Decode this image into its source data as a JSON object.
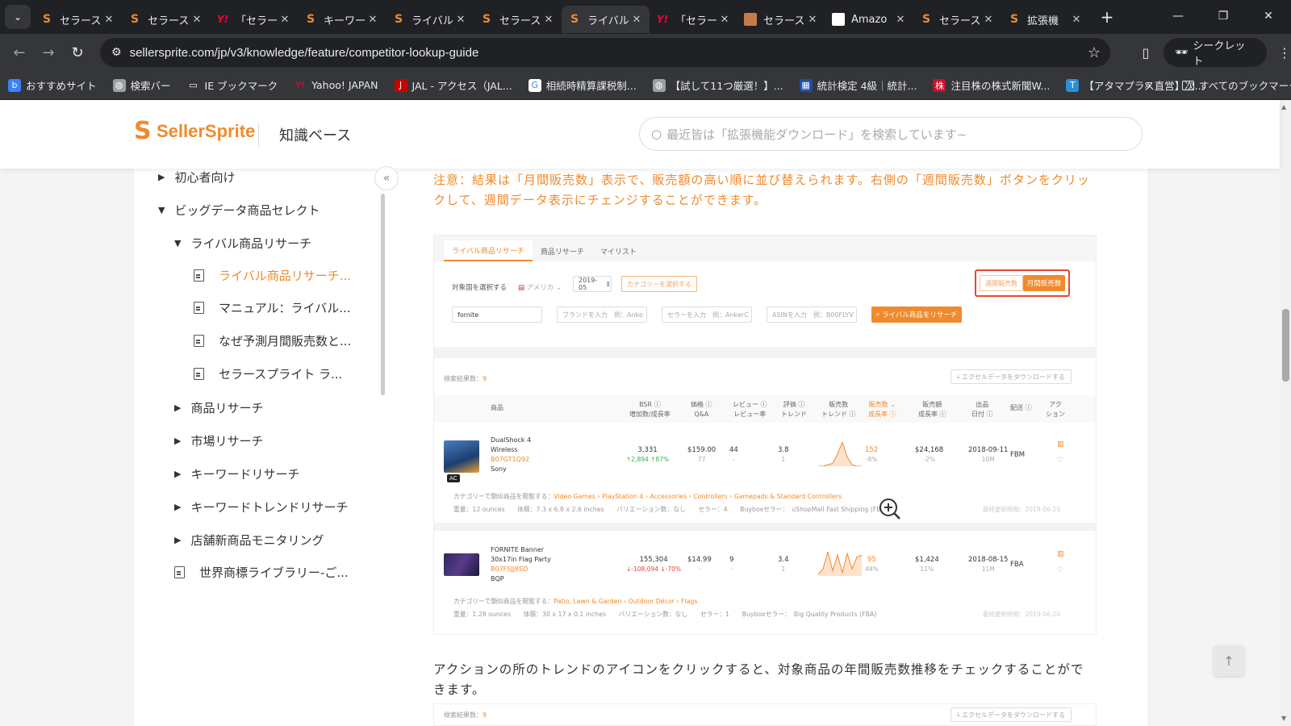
{
  "browser": {
    "tabs": [
      {
        "title": "セラース",
        "icon": "sellersprite-icon",
        "active": false
      },
      {
        "title": "セラース",
        "icon": "sellersprite-icon",
        "active": false
      },
      {
        "title": "「セラース",
        "icon": "yahoo-icon",
        "active": false
      },
      {
        "title": "キーワー",
        "icon": "sellersprite-icon",
        "active": false
      },
      {
        "title": "ライバル",
        "icon": "sellersprite-icon",
        "active": false
      },
      {
        "title": "セラース",
        "icon": "sellersprite-icon",
        "active": false
      },
      {
        "title": "ライバル",
        "icon": "sellersprite-icon",
        "active": true
      },
      {
        "title": "「セラース",
        "icon": "yahoo-icon",
        "active": false
      },
      {
        "title": "セラース",
        "icon": "person-photo-icon",
        "active": false
      },
      {
        "title": "Amazo",
        "icon": "amazon-icon",
        "active": false
      },
      {
        "title": "セラース",
        "icon": "sellersprite-icon",
        "active": false
      },
      {
        "title": "拡張機",
        "icon": "sellersprite-icon",
        "active": false
      }
    ],
    "url": "sellersprite.com/jp/v3/knowledge/feature/competitor-lookup-guide",
    "incognito_label": "シークレット",
    "bookmarks": [
      {
        "label": "おすすめサイト",
        "icon": "bing-icon"
      },
      {
        "label": "検索バー",
        "icon": "globe-icon"
      },
      {
        "label": "IE ブックマーク",
        "icon": "folder-icon"
      },
      {
        "label": "Yahoo! JAPAN",
        "icon": "yahoo-icon"
      },
      {
        "label": "JAL - アクセス（JAL...",
        "icon": "jal-icon"
      },
      {
        "label": "相続時精算課税制...",
        "icon": "google-icon"
      },
      {
        "label": "【試して11つ厳選！】...",
        "icon": "globe-icon"
      },
      {
        "label": "統計検定 4級｜統計...",
        "icon": "jssc-icon"
      },
      {
        "label": "注目株の株式新聞W...",
        "icon": "kabushiki-icon"
      },
      {
        "label": "【アタマプラス直営】次...",
        "icon": "t-icon"
      }
    ],
    "all_bookmarks_label": "すべてのブックマーク"
  },
  "header": {
    "logo_text": "SellerSprite",
    "section_title": "知識ベース",
    "search_placeholder": "最近皆は「拡張機能ダウンロード」を検索しています~"
  },
  "sidebar": {
    "items": [
      {
        "label": "初心者向け",
        "kind": "collapsed"
      },
      {
        "label": "ビッグデータ商品セレクト",
        "kind": "expanded"
      },
      {
        "label": "ライバル商品リサーチ",
        "kind": "expanded"
      },
      {
        "label": "ライバル商品リサーチ...",
        "kind": "doc-selected"
      },
      {
        "label": "マニュアル：ライバル...",
        "kind": "doc"
      },
      {
        "label": "なぜ予測月間販売数と...",
        "kind": "doc"
      },
      {
        "label": "セラースプライト ラ...",
        "kind": "doc"
      },
      {
        "label": "商品リサーチ",
        "kind": "collapsed"
      },
      {
        "label": "市場リサーチ",
        "kind": "collapsed"
      },
      {
        "label": "キーワードリサーチ",
        "kind": "collapsed"
      },
      {
        "label": "キーワードトレンドリサーチ",
        "kind": "collapsed"
      },
      {
        "label": "店舗新商品モニタリング",
        "kind": "collapsed"
      },
      {
        "label": "世界商標ライブラリー-ご...",
        "kind": "doc"
      }
    ]
  },
  "article": {
    "note": "注意：結果は「月間販売数」表示で、販売額の高い順に並び替えられます。右側の「週間販売数」ボタンをクリックして、週間データ表示にチェンジすることができます。",
    "paragraph": "アクションの所のトレンドのアイコンをクリックすると、対象商品の年間販売数推移をチェックすることができます。"
  },
  "screenshot": {
    "tabs": [
      "ライバル商品リサーチ",
      "商品リサーチ",
      "マイリスト"
    ],
    "country_label": "対象国を選択する",
    "country_value": "アメリカ",
    "date_value": "2019-05",
    "category_button": "カテゴリーを選択する",
    "weekly_label": "週間販売数",
    "monthly_label": "月間販売数",
    "keyword_value": "fornite",
    "brand_placeholder": "ブランドを入力　例：Anke",
    "seller_placeholder": "セラーを入力　例：AnkerC",
    "asin_placeholder": "ASINを入力　例：B00FLYV",
    "search_button": "ライバル商品をリサーチ",
    "results_label": "検索結果数：",
    "results_count": "9",
    "download_button": "エクセルデータをダウンロードする",
    "columns": [
      {
        "l1": "商品",
        "l2": ""
      },
      {
        "l1": "BSR ⓘ",
        "l2": "増加数/成長率"
      },
      {
        "l1": "価格 ⓘ",
        "l2": "Q&A"
      },
      {
        "l1": "レビュー ⓘ",
        "l2": "レビュー率"
      },
      {
        "l1": "評価 ⓘ",
        "l2": "トレンド"
      },
      {
        "l1": "販売数",
        "l2": "トレンド ⓘ"
      },
      {
        "l1": "販売数 ⌄",
        "l2": "成長率 ⓘ"
      },
      {
        "l1": "販売額",
        "l2": "成長率 ⓘ"
      },
      {
        "l1": "出品",
        "l2": "日付 ⓘ"
      },
      {
        "l1": "配送 ⓘ",
        "l2": ""
      },
      {
        "l1": "アク",
        "l2": "ション"
      }
    ],
    "rows": [
      {
        "name1": "DualShock 4",
        "name2": "Wireless",
        "asin": "B07GT1Q92",
        "brand": "Sony",
        "badge": "AC",
        "bsr": "3,331",
        "bsr_change": "↑2,894  ↑87%",
        "price": "$159.00",
        "qa": "77",
        "reviews": "44",
        "review_rate": "-",
        "rating": "3.8",
        "rating_trend": "1",
        "sales": "152",
        "sales_growth": "-8%",
        "revenue": "$24,168",
        "revenue_growth": "-2%",
        "date": "2018-09-11",
        "date_sub": "10M",
        "fulfillment": "FBM",
        "category_prefix": "カテゴリーで類似商品を閲覧する：",
        "category_path": "Video Games › PlayStation 4 › Accessories › Controllers › Gamepads & Standard Controllers",
        "details": "重量：12 ounces　　体積：7.3 x 6.8 x 2.6 inches　　バリエーション数：なし　　セラー：4　　Buyboxセラー：　uShopMall Fast Shipping (FBM)",
        "updated": "最終更新時間：2019-06-20",
        "sparkline": [
          0,
          0,
          1,
          2,
          8,
          16,
          6,
          1,
          0,
          0
        ]
      },
      {
        "name1": "FORNITE Banner",
        "name2": "30x17in Flag Party",
        "asin": "B07FSJJ8SD",
        "brand": "BQP",
        "badge": "",
        "bsr": "155,304",
        "bsr_change": "↓-108,094  ↓-70%",
        "price": "$14.99",
        "qa": "-",
        "reviews": "9",
        "review_rate": "-",
        "rating": "3.4",
        "rating_trend": "1",
        "sales": "95",
        "sales_growth": "48%",
        "revenue": "$1,424",
        "revenue_growth": "11%",
        "date": "2018-08-15",
        "date_sub": "11M",
        "fulfillment": "FBA",
        "category_prefix": "カテゴリーで類似商品を閲覧する：",
        "category_path": "Patio, Lawn & Garden › Outdoor Décor › Flags",
        "details": "重量：1.28 ounces　　体積：30 x 17 x 0.1 inches　　バリエーション数：なし　　セラー：1　　Buyboxセラー：　Big Quality Products (FBA)",
        "updated": "最終更新時間：2019-06-20",
        "sparkline": [
          1,
          4,
          14,
          3,
          12,
          2,
          13,
          4,
          11,
          12
        ]
      }
    ],
    "second_results_label": "検索結果数：",
    "second_results_count": "9",
    "second_download_button": "エクセルデータをダウンロードする"
  },
  "colors": {
    "accent": "#f08a2c",
    "highlight": "#e8472e",
    "chrome_dark": "#202124"
  }
}
